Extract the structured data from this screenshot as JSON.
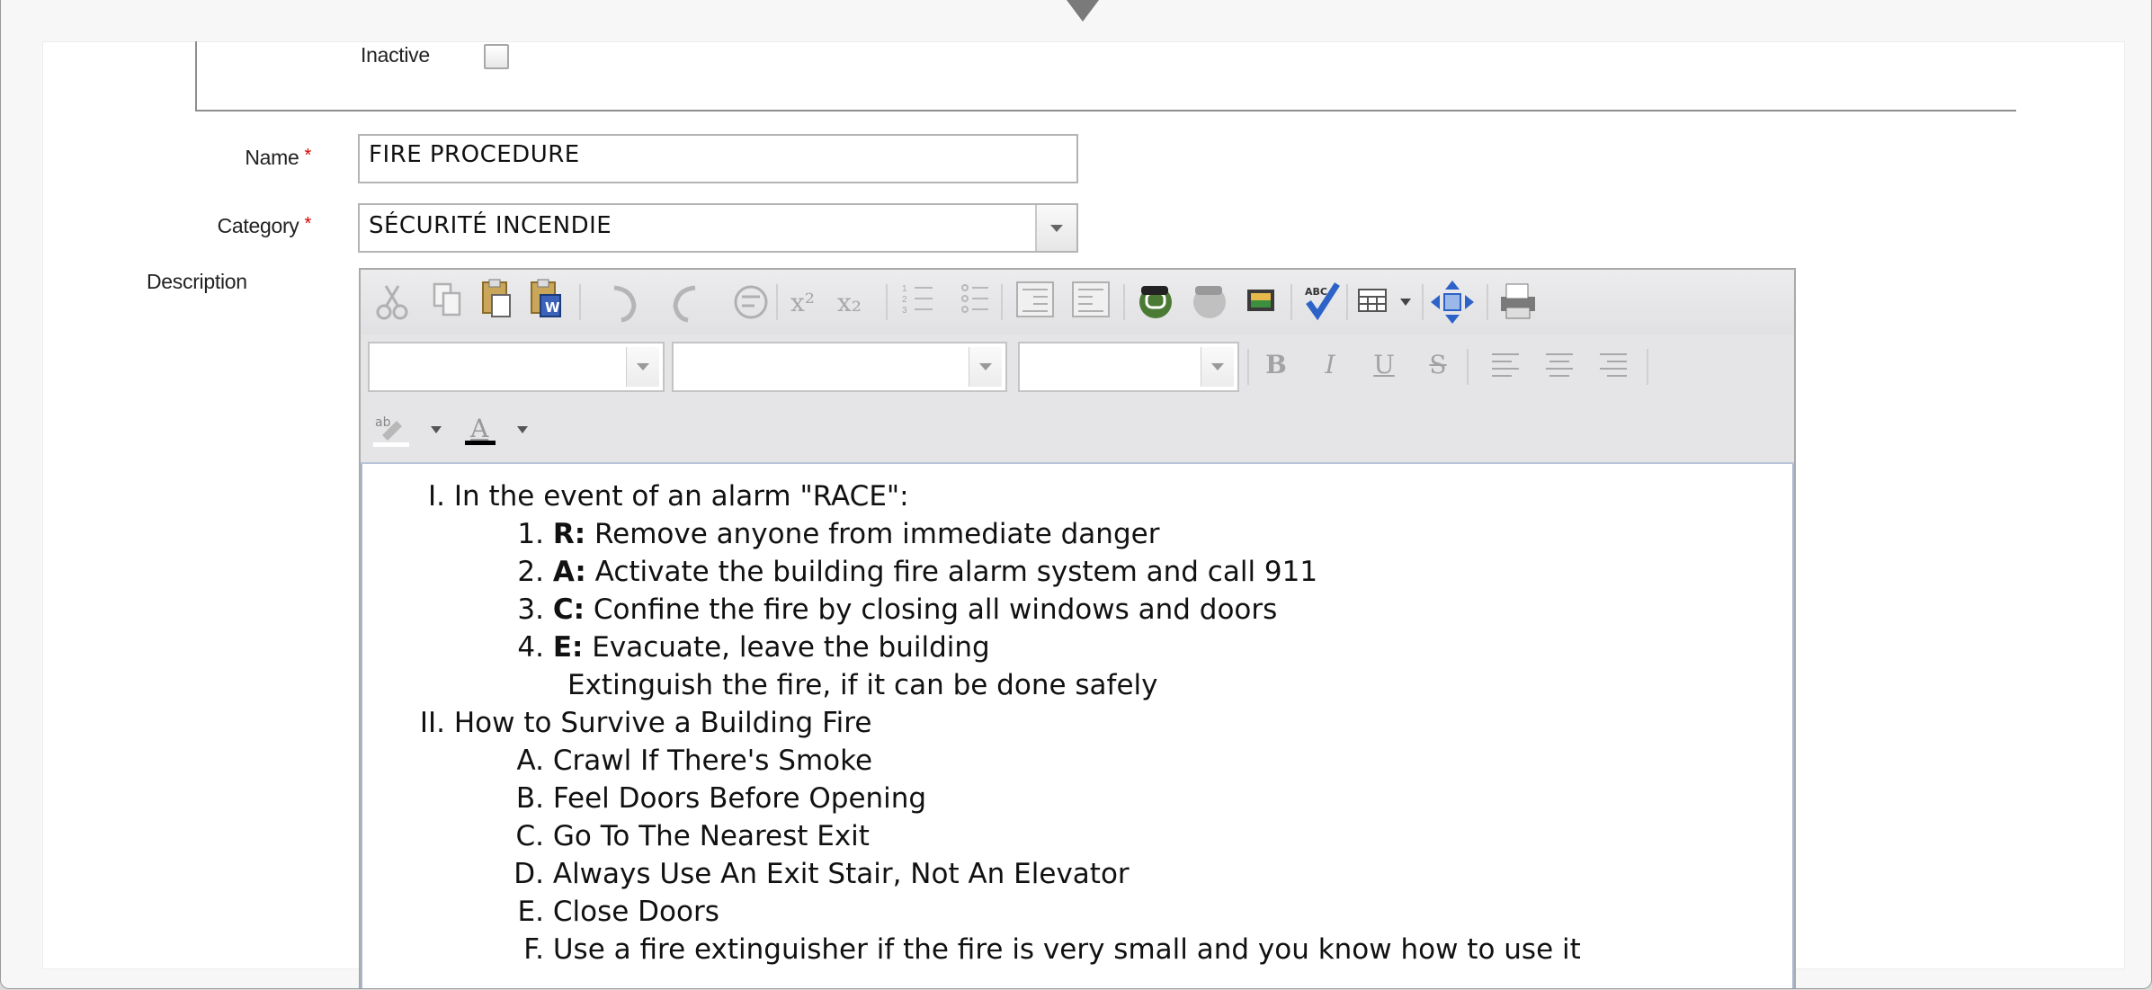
{
  "form": {
    "inactive_label": "Inactive",
    "name_label": "Name",
    "category_label": "Category",
    "description_label": "Description",
    "required_marker": "*",
    "name_value": "FIRE PROCEDURE",
    "category_value": "SÉCURITÉ INCENDIE"
  },
  "toolbar": {
    "row1_icons": [
      "cut-icon",
      "copy-icon",
      "paste-icon",
      "paste-from-word-icon",
      "undo-icon",
      "redo-icon",
      "paste-text-icon",
      "superscript-icon",
      "subscript-icon",
      "numbered-list-icon",
      "bulleted-list-icon",
      "decrease-indent-icon",
      "increase-indent-icon",
      "link-icon",
      "unlink-icon",
      "image-icon",
      "spellcheck-icon",
      "table-icon",
      "maximize-icon",
      "print-icon"
    ],
    "format_buttons": {
      "bold": "B",
      "italic": "I",
      "underline": "U",
      "strike": "S"
    },
    "text_color_glyph": "A",
    "highlight_glyph": "ab"
  },
  "content": {
    "section1": {
      "marker": "I.",
      "text": "In the event of an alarm \"RACE\":"
    },
    "race_items": [
      {
        "marker": "1.",
        "key": "R:",
        "text": " Remove anyone from immediate danger"
      },
      {
        "marker": "2.",
        "key": "A:",
        "text": " Activate the building fire alarm system and call 911"
      },
      {
        "marker": "3.",
        "key": "C:",
        "text": " Confine the fire by closing all windows and doors"
      },
      {
        "marker": "4.",
        "key": "E:",
        "text": " Evacuate, leave the building"
      }
    ],
    "race_extra": "Extinguish the fire, if it can be done safely",
    "section2": {
      "marker": "II.",
      "text": "How to Survive a Building Fire"
    },
    "survive_items": [
      {
        "marker": "A.",
        "text": "Crawl If There's Smoke"
      },
      {
        "marker": "B.",
        "text": "Feel Doors Before Opening"
      },
      {
        "marker": "C.",
        "text": "Go To The Nearest Exit"
      },
      {
        "marker": "D.",
        "text": "Always Use An Exit Stair, Not An Elevator"
      },
      {
        "marker": "E.",
        "text": "Close Doors"
      },
      {
        "marker": "F.",
        "text": "Use a fire extinguisher if the fire is very small and you know how to use it"
      }
    ]
  }
}
